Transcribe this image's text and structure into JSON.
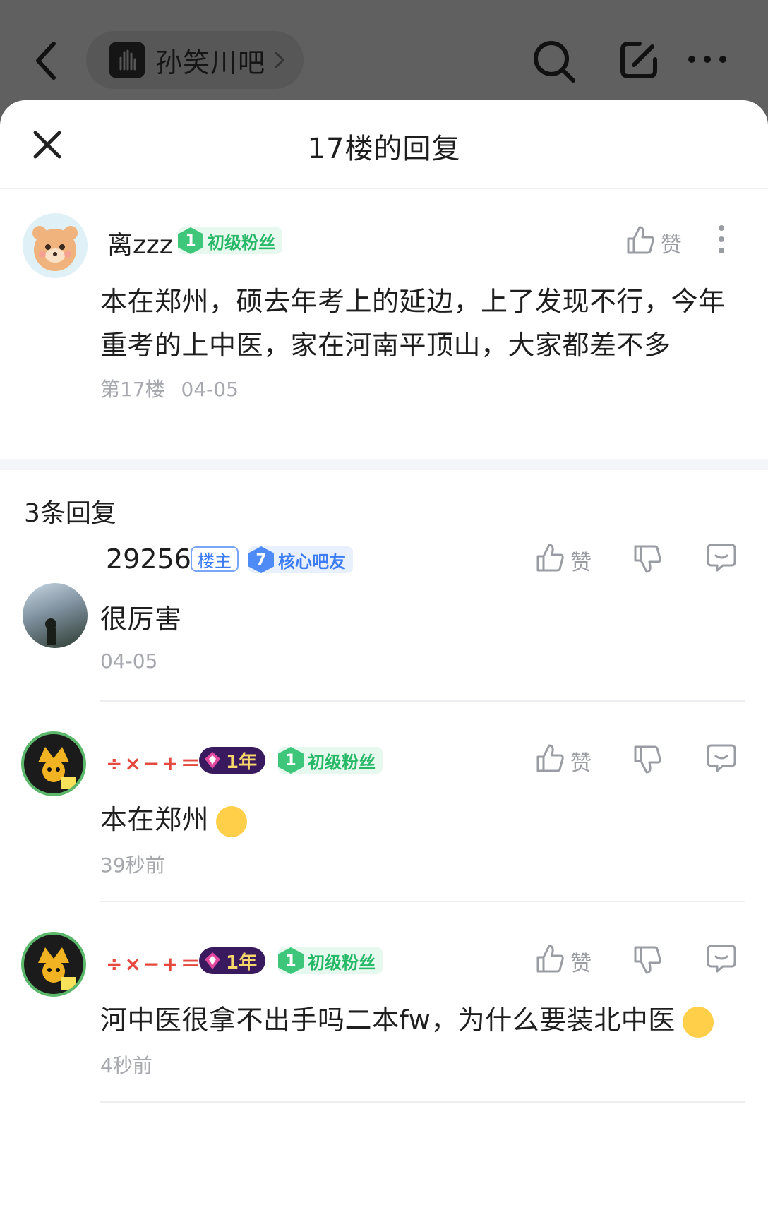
{
  "topbar": {
    "forum_name": "孙笑川吧"
  },
  "sheet": {
    "title": "17楼的回复"
  },
  "main_post": {
    "username": "离zzz",
    "level": "1",
    "level_title": "初级粉丝",
    "like_label": "赞",
    "content": "本在郑州，硕去年考上的延边，上了发现不行，今年重考的上中医，家在河南平顶山，大家都差不多",
    "floor": "第17楼",
    "date": "04-05"
  },
  "replies_header": "3条回复",
  "replies": [
    {
      "username": "29256",
      "owner_tag": "楼主",
      "level": "7",
      "level_title": "核心吧友",
      "like_label": "赞",
      "content": "很厉害",
      "time": "04-05"
    },
    {
      "username": "÷×−+＝",
      "year_tag": "1年",
      "level": "1",
      "level_title": "初级粉丝",
      "like_label": "赞",
      "content": "本在郑州",
      "emoji": "face-with-hand-over-mouth",
      "time": "39秒前"
    },
    {
      "username": "÷×−+＝",
      "year_tag": "1年",
      "level": "1",
      "level_title": "初级粉丝",
      "like_label": "赞",
      "content": "河中医很拿不出手吗二本fw，为什么要装北中医",
      "emoji": "confused-face",
      "time": "4秒前"
    }
  ],
  "colors": {
    "accent_blue": "#3b7cf5",
    "fan_green": "#25b867",
    "name_red": "#e5483d"
  }
}
